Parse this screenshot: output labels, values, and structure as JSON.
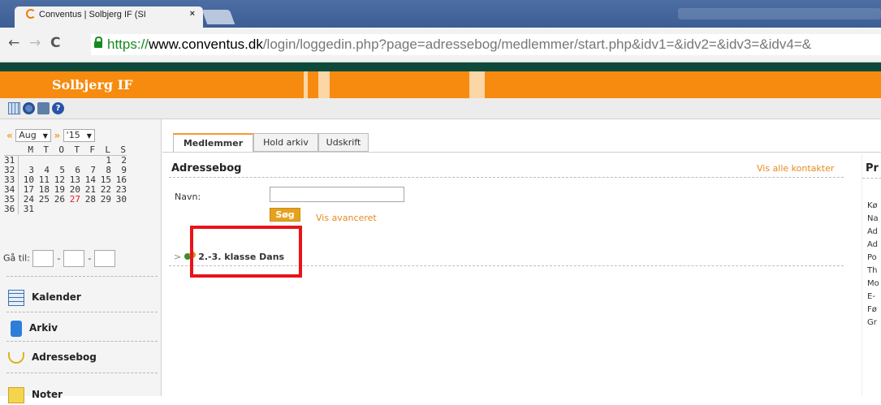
{
  "browser": {
    "tab_title": "Conventus | Solbjerg IF (SI",
    "tab_close": "×",
    "url_scheme": "https://",
    "url_host": "www.conventus.dk",
    "url_path": "/login/loggedin.php?page=adressebog/medlemmer/start.php&idv1=&idv2=&idv3=&idv4=&"
  },
  "site": {
    "title": "Solbjerg IF",
    "brand_color": "#f68b0f"
  },
  "calendar": {
    "month": "Aug",
    "year": "'15",
    "prev_arrow": "«",
    "next_arrow": "»",
    "weekday_headers": [
      "M",
      "T",
      "O",
      "T",
      "F",
      "L",
      "S"
    ],
    "weeks": [
      {
        "week": "31",
        "days": [
          "",
          "",
          "",
          "",
          "",
          "1",
          "2"
        ]
      },
      {
        "week": "32",
        "days": [
          "3",
          "4",
          "5",
          "6",
          "7",
          "8",
          "9"
        ]
      },
      {
        "week": "33",
        "days": [
          "10",
          "11",
          "12",
          "13",
          "14",
          "15",
          "16"
        ]
      },
      {
        "week": "34",
        "days": [
          "17",
          "18",
          "19",
          "20",
          "21",
          "22",
          "23"
        ]
      },
      {
        "week": "35",
        "days": [
          "24",
          "25",
          "26",
          "27",
          "28",
          "29",
          "30"
        ]
      },
      {
        "week": "36",
        "days": [
          "31",
          "",
          "",
          "",
          "",
          "",
          ""
        ]
      }
    ],
    "today": "27",
    "goto_label": "Gå til:"
  },
  "sidebar": {
    "items": [
      {
        "label": "Kalender",
        "icon": "calendar-icon"
      },
      {
        "label": "Arkiv",
        "icon": "archive-icon"
      },
      {
        "label": "Adressebog",
        "icon": "addressbook-icon"
      },
      {
        "label": "Noter",
        "icon": "notes-icon"
      }
    ]
  },
  "main": {
    "tabs": [
      "Medlemmer",
      "Hold arkiv",
      "Udskrift"
    ],
    "active_tab": "Medlemmer",
    "heading": "Adressebog",
    "show_all_link": "Vis alle kontakter",
    "name_label": "Navn:",
    "name_value": "",
    "search_button": "Søg",
    "advanced_link": "Vis avanceret",
    "groups": [
      {
        "label": "2.-3. klasse Dans"
      }
    ]
  },
  "right_panel": {
    "title": "Pr",
    "items": [
      "Kø",
      "Na",
      "Ad",
      "Ad",
      "Po",
      "Th",
      "Mo",
      "E-",
      "Fø",
      "Gr"
    ]
  }
}
